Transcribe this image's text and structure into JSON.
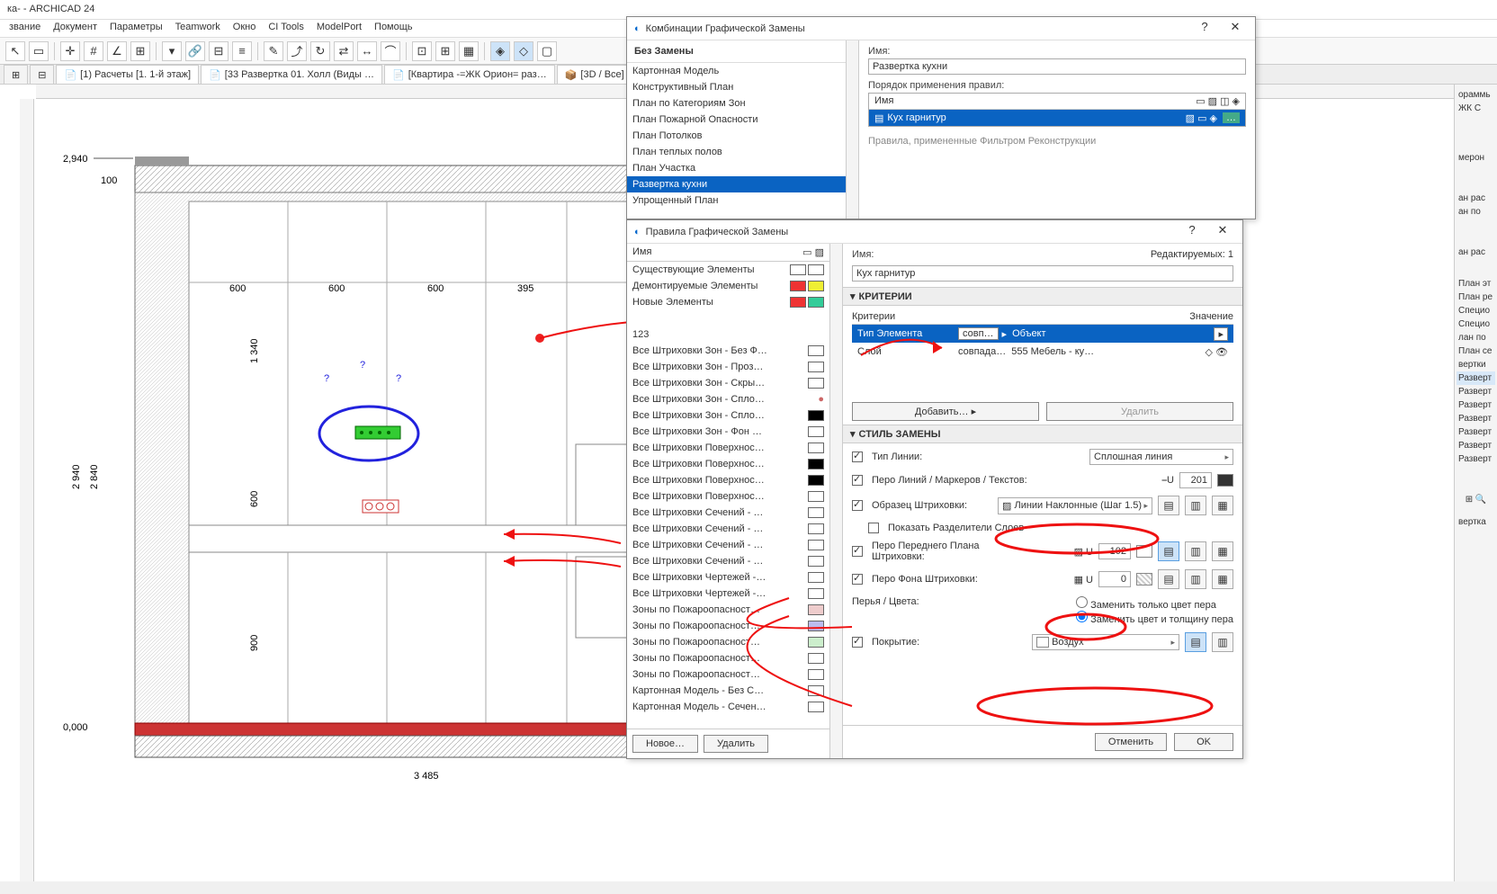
{
  "app": {
    "title": "ка- - ARCHICAD 24"
  },
  "menu": [
    "звание",
    "Документ",
    "Параметры",
    "Teamwork",
    "Окно",
    "CI Tools",
    "ModelPort",
    "Помощь"
  ],
  "tabs": [
    {
      "icon": "📄",
      "label": "[1) Расчеты [1. 1-й этаж]"
    },
    {
      "icon": "📄",
      "label": "[33 Развертка 01. Холл (Виды …"
    },
    {
      "icon": "📄",
      "label": "[Квартира -=ЖК Орион= раз…"
    },
    {
      "icon": "📦",
      "label": "[3D / Все]"
    }
  ],
  "dims": {
    "top": "2,940",
    "left_rot": "2 940",
    "left_rot2": "2 840",
    "bottom": "3 485",
    "base": "0,000",
    "v1": "100",
    "v2": "1 340",
    "v3": "600",
    "v4": "900",
    "h1": "600",
    "h2": "600",
    "h3": "600",
    "h4": "395"
  },
  "dlg1": {
    "title": "Комбинации Графической Замены",
    "left_header": "Без Замены",
    "combos": [
      "Картонная Модель",
      "Конструктивный План",
      "План по Категориям Зон",
      "План Пожарной Опасности",
      "План Потолков",
      "План теплых полов",
      "План Участка",
      "Развертка кухни",
      "Упрощенный План"
    ],
    "selected": "Развертка кухни",
    "name_label": "Имя:",
    "name_value": "Развертка кухни",
    "order_label": "Порядок применения правил:",
    "col_name": "Имя",
    "rule": "Кух гарнитур",
    "filter_note": "Правила, примененные Фильтром Реконструкции"
  },
  "dlg2": {
    "title": "Правила Графической Замены",
    "col_name": "Имя",
    "rules": [
      {
        "n": "Существующие Элементы",
        "c1": "#fff",
        "c2": "#fff"
      },
      {
        "n": "Демонтируемые Элементы",
        "c1": "#e33",
        "c2": "#ee3"
      },
      {
        "n": "Новые Элементы",
        "c1": "#e33",
        "c2": "#3c9"
      },
      {
        "n": "",
        "c1": "",
        "c2": ""
      },
      {
        "n": "123",
        "c1": "",
        "c2": ""
      },
      {
        "n": "Все Штриховки Зон - Без Ф…",
        "c1": "#fff",
        "c2": ""
      },
      {
        "n": "Все Штриховки Зон - Проз…",
        "c1": "#fff",
        "c2": ""
      },
      {
        "n": "Все Штриховки Зон - Скры…",
        "c1": "#fff",
        "c2": ""
      },
      {
        "n": "Все Штриховки Зон - Спло…",
        "c1": "",
        "c2": "",
        "icon": "●"
      },
      {
        "n": "Все Штриховки Зон - Спло…",
        "c1": "#000",
        "c2": ""
      },
      {
        "n": "Все Штриховки Зон - Фон К…",
        "c1": "#fff",
        "c2": ""
      },
      {
        "n": "Все Штриховки Поверхнос…",
        "c1": "#fff",
        "c2": ""
      },
      {
        "n": "Все Штриховки Поверхнос…",
        "c1": "#000",
        "c2": ""
      },
      {
        "n": "Все Штриховки Поверхнос…",
        "c1": "#000",
        "c2": ""
      },
      {
        "n": "Все Штриховки Поверхнос…",
        "c1": "#fff",
        "c2": ""
      },
      {
        "n": "Все Штриховки Сечений - …",
        "c1": "#fff",
        "c2": ""
      },
      {
        "n": "Все Штриховки Сечений - …",
        "c1": "#fff",
        "c2": ""
      },
      {
        "n": "Все Штриховки Сечений - …",
        "c1": "#fff",
        "c2": ""
      },
      {
        "n": "Все Штриховки Сечений - …",
        "c1": "#fff",
        "c2": ""
      },
      {
        "n": "Все Штриховки Чертежей -…",
        "c1": "#fff",
        "c2": ""
      },
      {
        "n": "Все Штриховки Чертежей -…",
        "c1": "#fff",
        "c2": ""
      },
      {
        "n": "Зоны по Пожароопасност…",
        "c1": "#ecc",
        "c2": ""
      },
      {
        "n": "Зоны по Пожароопасност…",
        "c1": "#bbe",
        "c2": ""
      },
      {
        "n": "Зоны по Пожароопасност…",
        "c1": "#cec",
        "c2": ""
      },
      {
        "n": "Зоны по Пожароопасност…",
        "c1": "#fff",
        "c2": ""
      },
      {
        "n": "Зоны по Пожароопасност…",
        "c1": "#fff",
        "c2": ""
      },
      {
        "n": "Картонная Модель - Без Се…",
        "c1": "#fff",
        "c2": ""
      },
      {
        "n": "Картонная Модель - Сечен…",
        "c1": "#fff",
        "c2": ""
      }
    ],
    "new_btn": "Новое…",
    "del_btn": "Удалить",
    "right": {
      "name_label": "Имя:",
      "edit_label": "Редактируемых: 1",
      "name_value": "Кух гарнитур",
      "crit_hdr": "КРИТЕРИИ",
      "crit_col": "Критерии",
      "val_col": "Значение",
      "r1": {
        "k": "Тип Элемента",
        "op": "совп…",
        "v": "Объект"
      },
      "r2": {
        "k": "Слой",
        "op": "совпада…",
        "v": "555 Мебель - ку…"
      },
      "add_btn": "Добавить…",
      "del_btn": "Удалить",
      "style_hdr": "СТИЛЬ ЗАМЕНЫ",
      "line_type": "Тип Линии:",
      "line_type_v": "Сплошная линия",
      "pen_marker": "Перо Линий / Маркеров / Текстов:",
      "pen_marker_v": "201",
      "fill_pattern": "Образец Штриховки:",
      "fill_pattern_v": "Линии Наклонные (Шаг 1.5)",
      "show_sep": "Показать Разделители Слоев",
      "fg_pen": "Перо Переднего Плана Штриховки:",
      "fg_pen_v": "102",
      "bg_pen": "Перо Фона Штриховки:",
      "bg_pen_v": "0",
      "radio1": "Заменить только цвет пера",
      "radio2": "Заменить цвет и толщину пера",
      "pen_color": "Перья / Цвета:",
      "coverage": "Покрытие:",
      "coverage_v": "Воздух",
      "cancel": "Отменить",
      "ok": "OK"
    }
  },
  "right_panel": [
    "ораммь",
    "ЖК С",
    "мерон",
    "ан рас",
    "ан по",
    "ан рас",
    "План эт",
    "План ре",
    "Специо",
    "Специо",
    "лан по",
    "План се",
    "вертки",
    "Разверт",
    "Разверт",
    "Разверт",
    "Разверт",
    "Разверт",
    "Разверт",
    "Разверт",
    "вертка"
  ]
}
